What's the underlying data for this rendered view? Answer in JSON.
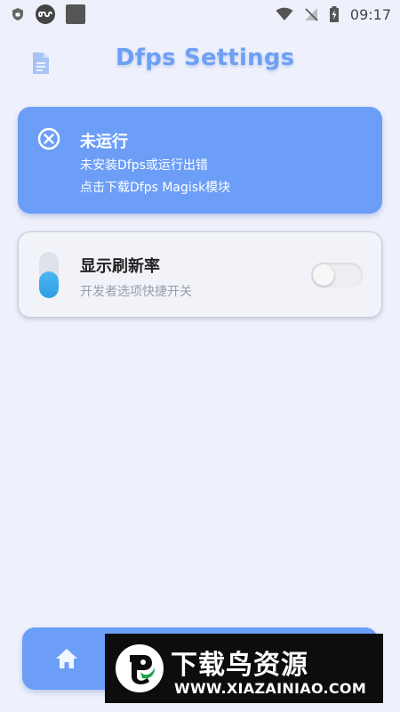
{
  "status_bar": {
    "time": "09:17",
    "icons": [
      "shield-icon",
      "infinity-app-icon",
      "square-app-icon",
      "wifi-icon",
      "no-signal-icon",
      "battery-charging-icon"
    ]
  },
  "header": {
    "title": "Dfps Settings",
    "icon": "document-icon"
  },
  "status_card": {
    "icon": "close-circle-icon",
    "title": "未运行",
    "line1": "未安装Dfps或运行出错",
    "line2": "点击下载Dfps Magisk模块",
    "color": "#6c9ef8"
  },
  "refresh_card": {
    "icon": "level-pill-icon",
    "title": "显示刷新率",
    "subtitle": "开发者选项快捷开关",
    "toggle_on": false
  },
  "bottom_nav": {
    "items": [
      {
        "icon": "home-icon"
      }
    ]
  },
  "watermark": {
    "title": "下载鸟资源",
    "url": "WWW.XIAZAINIAO.COM"
  },
  "colors": {
    "accent": "#6c9ef8",
    "background": "#eef0fb"
  }
}
